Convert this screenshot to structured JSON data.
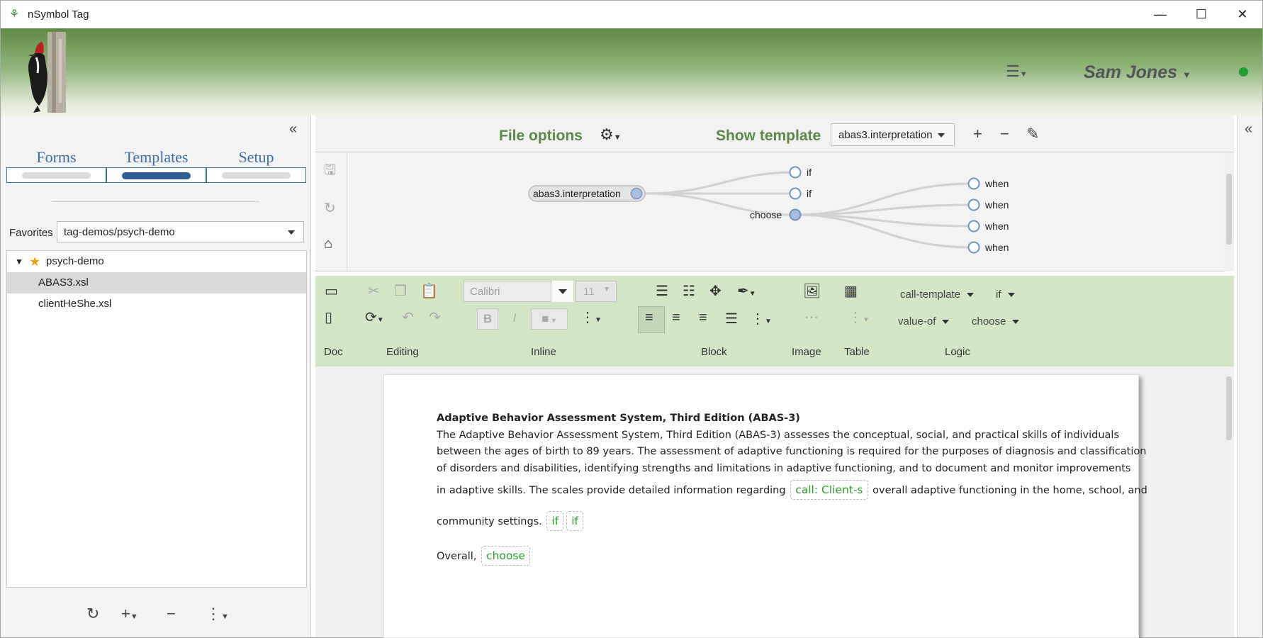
{
  "window": {
    "title": "nSymbol Tag",
    "controls": [
      "—",
      "☐",
      "✕"
    ]
  },
  "header": {
    "user_name": "Sam Jones",
    "menu_icon": "hamburger-menu-icon",
    "status_color": "#1f9d2f"
  },
  "left_panel": {
    "tabs": [
      {
        "label": "Forms",
        "active": false
      },
      {
        "label": "Templates",
        "active": true
      },
      {
        "label": "Setup",
        "active": false
      }
    ],
    "favorites_label": "Favorites",
    "favorites_value": "tag-demos/psych-demo",
    "tree": {
      "root": "psych-demo",
      "files": [
        "ABAS3.xsl",
        "clientHeShe.xsl"
      ],
      "selected": "ABAS3.xsl"
    }
  },
  "topbar": {
    "file_options": "File options",
    "show_template": "Show template",
    "template_value": "abas3.interpretation"
  },
  "diagram": {
    "root": "abas3.interpretation",
    "children": [
      "if",
      "if",
      "choose"
    ],
    "choose_children": [
      "when",
      "when",
      "when",
      "when"
    ]
  },
  "ribbon": {
    "font_name": "Calibri",
    "font_size": "11",
    "dropdowns": {
      "call_template": "call-template",
      "if": "if",
      "value_of": "value-of",
      "choose": "choose"
    },
    "groups": {
      "doc": "Doc",
      "editing": "Editing",
      "inline": "Inline",
      "block": "Block",
      "image": "Image",
      "table": "Table",
      "logic": "Logic"
    },
    "colors": {
      "ribbon_bg": "#d3e6c6",
      "accent": "#5b8a46"
    }
  },
  "document": {
    "title": "Adaptive Behavior Assessment System, Third Edition (ABAS-3)",
    "line1": "The Adaptive Behavior Assessment System, Third Edition (ABAS-3) assesses the conceptual, social, and practical skills of individuals",
    "line2": "between the ages of birth to 89 years. The assessment of adaptive functioning is required for the purposes of diagnosis and classification",
    "line3": "of disorders and disabilities, identifying strengths and limitations in adaptive functioning, and to document and monitor improvements",
    "line4a": "in adaptive skills. The scales provide detailed information regarding",
    "chip_call": "call: Client-s",
    "line4b": "overall adaptive functioning in the home, school, and",
    "line5": "community settings.",
    "chip_if1": "if",
    "chip_if2": "if",
    "line6": "Overall,",
    "chip_choose": "choose"
  }
}
